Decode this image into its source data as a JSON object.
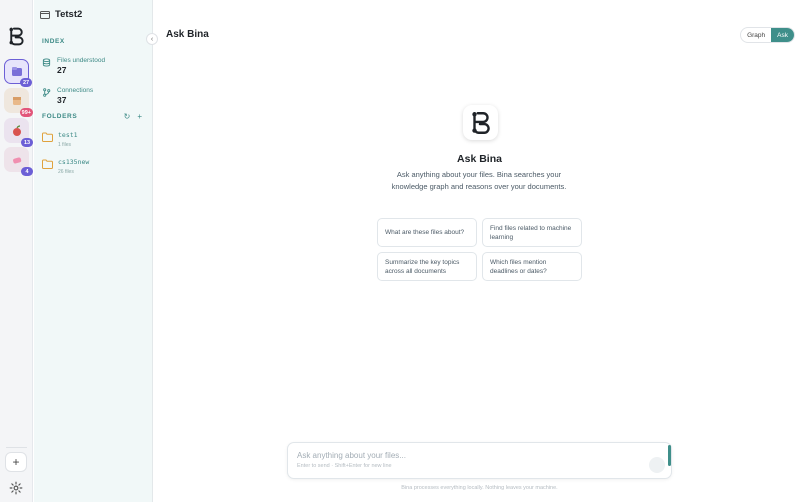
{
  "colors": {
    "accent": "#3f8f8a",
    "rail_active": "#6c5fd6",
    "badge_red": "#e2557a"
  },
  "rail": {
    "workspaces": [
      {
        "badge": "27",
        "icon": "folder-icon"
      },
      {
        "badge": "99+",
        "icon": "box-icon"
      },
      {
        "badge": "13",
        "icon": "apple-icon"
      },
      {
        "badge": "4",
        "icon": "eraser-icon"
      }
    ],
    "add_label": "+",
    "settings_icon": "gear-icon"
  },
  "sidebar": {
    "title": "Tetst2",
    "index_label": "INDEX",
    "stats": [
      {
        "label": "Files understood",
        "value": "27",
        "icon": "database-icon"
      },
      {
        "label": "Connections",
        "value": "37",
        "icon": "branch-icon"
      }
    ],
    "folders_label": "FOLDERS",
    "folders": [
      {
        "name": "test1",
        "count": "1 files"
      },
      {
        "name": "cs135new",
        "count": "26 files"
      }
    ]
  },
  "main": {
    "title": "Ask Bina",
    "view_toggle": {
      "graph": "Graph",
      "ask": "Ask"
    },
    "hero_title": "Ask Bina",
    "hero_description": "Ask anything about your files. Bina searches your knowledge graph and reasons over your documents.",
    "suggestions": [
      "What are these files about?",
      "Find files related to machine learning",
      "Summarize the key topics across all documents",
      "Which files mention deadlines or dates?"
    ],
    "input": {
      "placeholder": "Ask anything about your files...",
      "hint": "Enter to send · Shift+Enter for new line"
    },
    "footer_note": "Bina processes everything locally. Nothing leaves your machine."
  }
}
